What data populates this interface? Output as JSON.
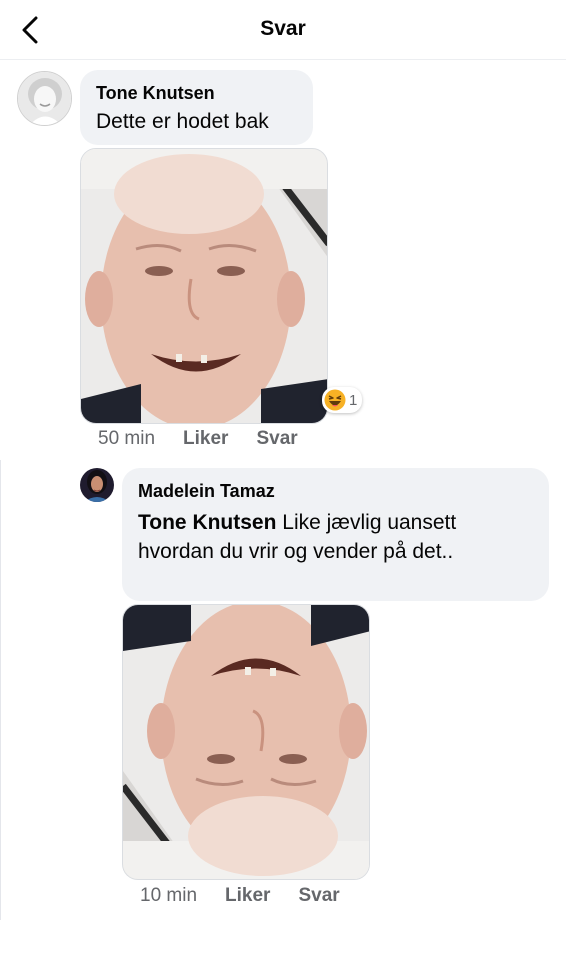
{
  "header": {
    "title": "Svar"
  },
  "comment": {
    "author": "Tone Knutsen",
    "text": "Dette er hodet bak",
    "time": "50 min",
    "like_label": "Liker",
    "reply_label": "Svar",
    "reaction": {
      "icon": "haha-emoji-icon",
      "count": "1"
    }
  },
  "reply": {
    "author": "Madelein Tamaz",
    "mention": "Tone Knutsen",
    "text": " Like jævlig uansett hvordan du vrir og vender på det..",
    "time": "10 min",
    "like_label": "Liker",
    "reply_label": "Svar"
  },
  "colors": {
    "bubble": "#f0f2f5",
    "meta": "#65676b",
    "text": "#050505"
  }
}
